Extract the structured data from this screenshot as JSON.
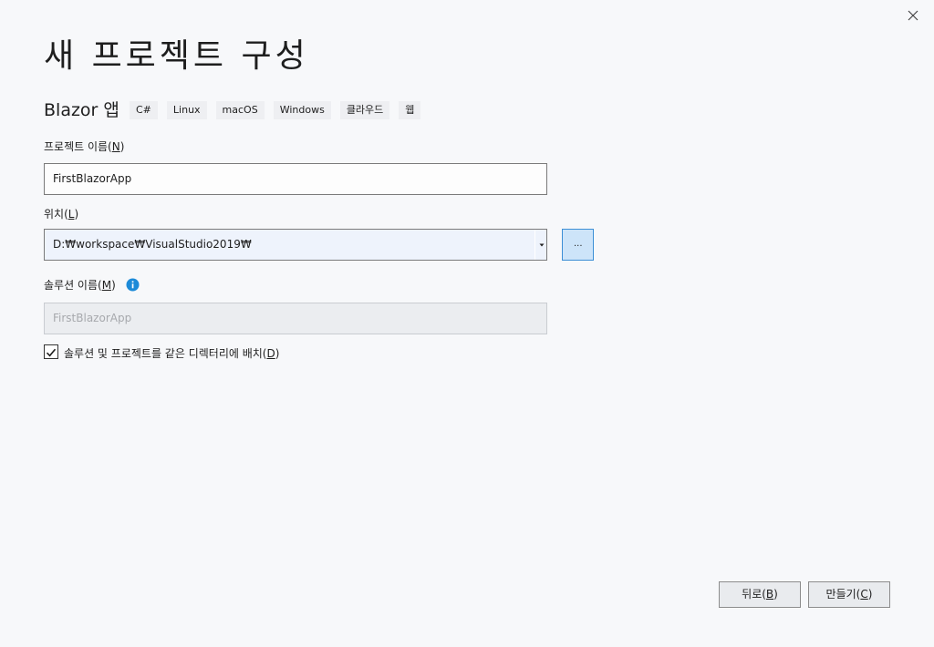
{
  "window": {
    "title": "새 프로젝트 구성",
    "close_icon": "close-icon"
  },
  "template": {
    "name": "Blazor 앱",
    "tags": [
      "C#",
      "Linux",
      "macOS",
      "Windows",
      "클라우드",
      "웹"
    ]
  },
  "project_name": {
    "label_prefix": "프로젝트 이름(",
    "label_key": "N",
    "label_suffix": ")",
    "value": "FirstBlazorApp"
  },
  "location": {
    "label_prefix": "위치(",
    "label_key": "L",
    "label_suffix": ")",
    "value": "D:₩workspace₩VisualStudio2019₩",
    "browse_label": "..."
  },
  "solution_name": {
    "label_prefix": "솔루션 이름(",
    "label_key": "M",
    "label_suffix": ")",
    "value": "FirstBlazorApp",
    "info_icon": "info-icon",
    "info_color": "#1c8ad8"
  },
  "same_directory": {
    "checked": true,
    "label_prefix": "솔루션 및 프로젝트를 같은 디렉터리에 배치(",
    "label_key": "D",
    "label_suffix": ")"
  },
  "footer": {
    "back_prefix": "뒤로(",
    "back_key": "B",
    "back_suffix": ")",
    "create_prefix": "만들기(",
    "create_key": "C",
    "create_suffix": ")"
  }
}
